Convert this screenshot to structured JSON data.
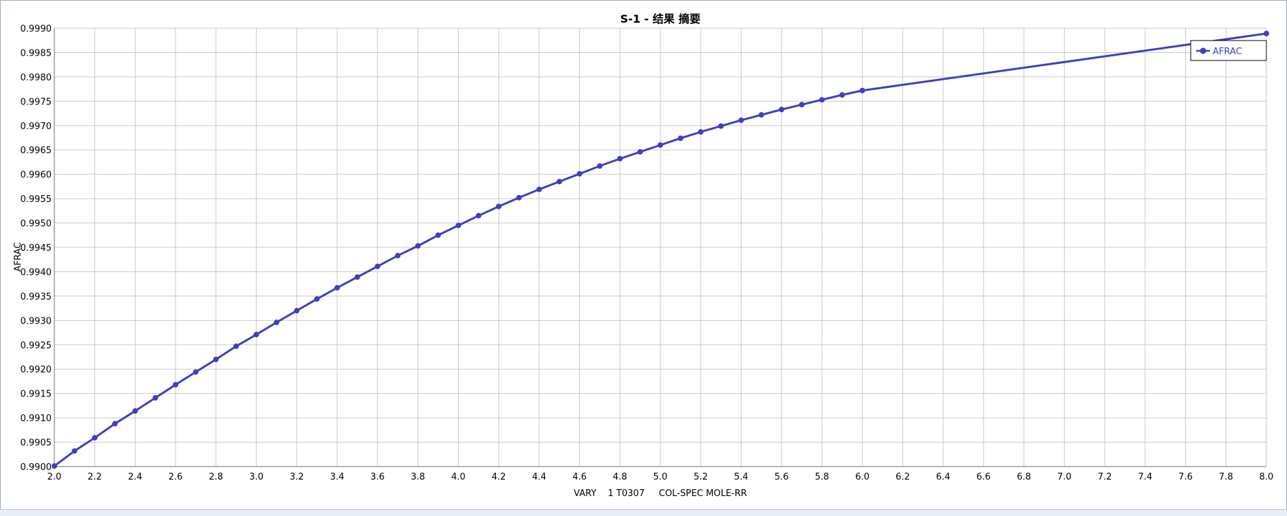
{
  "chart_data": {
    "type": "line",
    "title": "S-1 - 结果 摘要",
    "xlabel": "VARY    1 T0307     COL-SPEC MOLE-RR",
    "ylabel": "AFRAC",
    "xlim": [
      2.0,
      8.0
    ],
    "ylim": [
      0.99,
      0.999
    ],
    "x_ticks": [
      2.0,
      2.2,
      2.4,
      2.6,
      2.8,
      3.0,
      3.2,
      3.4,
      3.6,
      3.8,
      4.0,
      4.2,
      4.4,
      4.6,
      4.8,
      5.0,
      5.2,
      5.4,
      5.6,
      5.8,
      6.0,
      6.2,
      6.4,
      6.6,
      6.8,
      7.0,
      7.2,
      7.4,
      7.6,
      7.8,
      8.0
    ],
    "y_ticks": [
      0.99,
      0.9905,
      0.991,
      0.9915,
      0.992,
      0.9925,
      0.993,
      0.9935,
      0.994,
      0.9945,
      0.995,
      0.9955,
      0.996,
      0.9965,
      0.997,
      0.9975,
      0.998,
      0.9985,
      0.999
    ],
    "x_tick_decimals": 1,
    "y_tick_decimals": 4,
    "grid": true,
    "legend_position": "top-right",
    "series": [
      {
        "name": "AFRAC",
        "color": "#3f3fbf",
        "x": [
          2.0,
          2.1,
          2.2,
          2.3,
          2.4,
          2.5,
          2.6,
          2.7,
          2.8,
          2.9,
          3.0,
          3.1,
          3.2,
          3.3,
          3.4,
          3.5,
          3.6,
          3.7,
          3.8,
          3.9,
          4.0,
          4.1,
          4.2,
          4.3,
          4.4,
          4.5,
          4.6,
          4.7,
          4.8,
          4.9,
          5.0,
          5.1,
          5.2,
          5.3,
          5.4,
          5.5,
          5.6,
          5.7,
          5.8,
          5.9,
          6.0,
          8.0
        ],
        "y": [
          0.99001,
          0.99032,
          0.99059,
          0.99088,
          0.99114,
          0.99141,
          0.99168,
          0.99194,
          0.9922,
          0.99247,
          0.99271,
          0.99296,
          0.9932,
          0.99344,
          0.99367,
          0.99389,
          0.99411,
          0.99433,
          0.99453,
          0.99475,
          0.99495,
          0.99515,
          0.99534,
          0.99552,
          0.99569,
          0.99585,
          0.99601,
          0.99617,
          0.99632,
          0.99646,
          0.9966,
          0.99674,
          0.99687,
          0.99699,
          0.99711,
          0.99722,
          0.99733,
          0.99743,
          0.99753,
          0.99763,
          0.99772,
          0.99889
        ]
      }
    ]
  }
}
